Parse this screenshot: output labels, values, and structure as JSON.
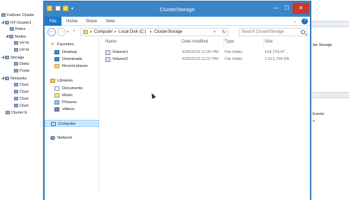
{
  "background_app": {
    "tree": [
      {
        "label": "Failover Cluster",
        "indent": 0,
        "expander": ""
      },
      {
        "label": "HY-Cluster1",
        "indent": 1,
        "expander": "◢"
      },
      {
        "label": "Roles",
        "indent": 2,
        "expander": ""
      },
      {
        "label": "Nodes",
        "indent": 1,
        "expander": "◢"
      },
      {
        "label": "HY-N",
        "indent": 3,
        "expander": ""
      },
      {
        "label": "HY-N",
        "indent": 3,
        "expander": ""
      },
      {
        "label": "Storage",
        "indent": 1,
        "expander": "◢"
      },
      {
        "label": "Disks",
        "indent": 3,
        "expander": ""
      },
      {
        "label": "Pools",
        "indent": 3,
        "expander": ""
      },
      {
        "label": "Networks",
        "indent": 1,
        "expander": "◢"
      },
      {
        "label": "Clust",
        "indent": 3,
        "expander": ""
      },
      {
        "label": "Clust",
        "indent": 3,
        "expander": ""
      },
      {
        "label": "Clust",
        "indent": 3,
        "expander": ""
      },
      {
        "label": "Clust",
        "indent": 3,
        "expander": ""
      },
      {
        "label": "Cluster E",
        "indent": 2,
        "expander": ""
      }
    ],
    "right_pane": {
      "item1": "ble Storage",
      "item2": "Events",
      "item3": "s"
    }
  },
  "explorer": {
    "title": "ClusterStorage",
    "controls": {
      "minimize": "—",
      "maximize": "☐",
      "close": "✕"
    },
    "ribbon_tabs": [
      "File",
      "Home",
      "Share",
      "View"
    ],
    "address": {
      "segments": [
        "Computer",
        "Local Disk (C:)",
        "ClusterStorage"
      ],
      "separator": "▸"
    },
    "search": {
      "placeholder": "Search ClusterStorage"
    },
    "nav_pane": {
      "favorites": {
        "label": "Favorites",
        "items": [
          "Desktop",
          "Downloads",
          "Recent places"
        ]
      },
      "libraries": {
        "label": "Libraries",
        "items": [
          "Documents",
          "Music",
          "Pictures",
          "Videos"
        ]
      },
      "computer": "Computer",
      "network": "Network"
    },
    "columns": [
      "Name",
      "Date modified",
      "Type",
      "Size"
    ],
    "files": [
      {
        "name": "Volume1",
        "date": "6/20/2013 11:35 PM",
        "type": "File folder",
        "size": "104,724,47..."
      },
      {
        "name": "Volume2",
        "date": "6/20/2013 11:37 PM",
        "type": "File folder",
        "size": "1,013,756 KB"
      }
    ]
  },
  "colors": {
    "title_bar": "#3a86c8",
    "file_tab": "#1979ca",
    "close_button": "#c7392d",
    "selected": "#cce8ff"
  }
}
